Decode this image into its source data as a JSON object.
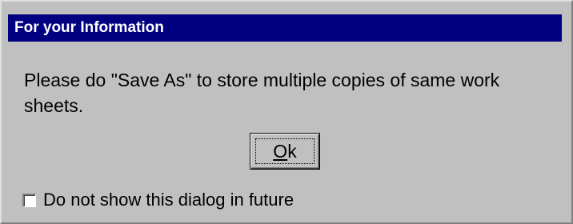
{
  "dialog": {
    "title": "For your Information",
    "message": "Please do  \"Save As\" to store multiple copies of same work sheets.",
    "ok_button": {
      "mnemonic": "O",
      "rest": "k"
    },
    "checkbox": {
      "label": "Do not show this dialog in future",
      "checked": false
    }
  },
  "colors": {
    "title_bar": "#000080",
    "face": "#c0c0c0"
  }
}
